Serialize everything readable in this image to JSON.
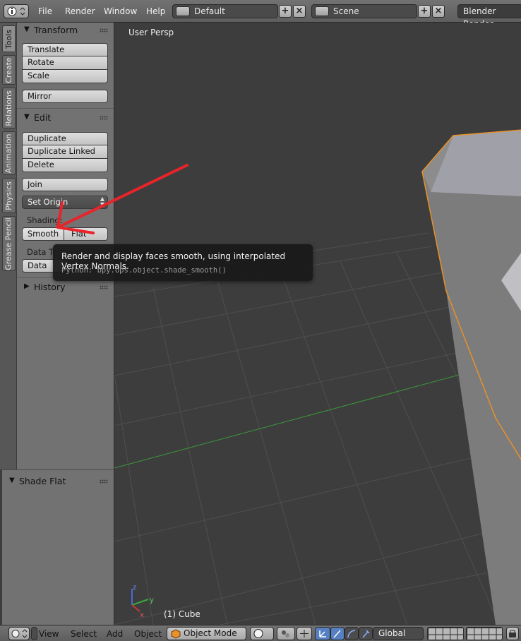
{
  "topbar": {
    "menus": [
      "File",
      "Render",
      "Window",
      "Help"
    ],
    "screen_layout": "Default",
    "scene": "Scene",
    "render_engine": "Blender Render"
  },
  "tabs": [
    "Tools",
    "Create",
    "Relations",
    "Animation",
    "Physics",
    "Grease Pencil"
  ],
  "toolshelf": {
    "transform": {
      "title": "Transform",
      "buttons": [
        "Translate",
        "Rotate",
        "Scale"
      ],
      "mirror": "Mirror"
    },
    "edit": {
      "title": "Edit",
      "buttons": [
        "Duplicate",
        "Duplicate Linked",
        "Delete"
      ],
      "join": "Join",
      "set_origin": "Set Origin",
      "shading_label": "Shading:",
      "smooth": "Smooth",
      "flat": "Flat",
      "data_transfer_label": "Data Tr",
      "data_button": "Data"
    },
    "history": {
      "title": "History"
    }
  },
  "operator_panel": {
    "title": "Shade Flat"
  },
  "viewport": {
    "view_label": "User Persp",
    "object_label": "(1) Cube",
    "axis_labels": {
      "x": "x",
      "y": "y",
      "z": "z"
    }
  },
  "tooltip": {
    "text": "Render and display faces smooth, using interpolated Vertex Normals.",
    "python": "Python: bpy.ops.object.shade_smooth()"
  },
  "bottombar": {
    "menus": [
      "View",
      "Select",
      "Add",
      "Object"
    ],
    "mode": "Object Mode",
    "orientation": "Global"
  },
  "colors": {
    "selection_outline": "#e8902a",
    "annotation_arrow": "#e8242a",
    "x_axis": "#2aa12a"
  }
}
